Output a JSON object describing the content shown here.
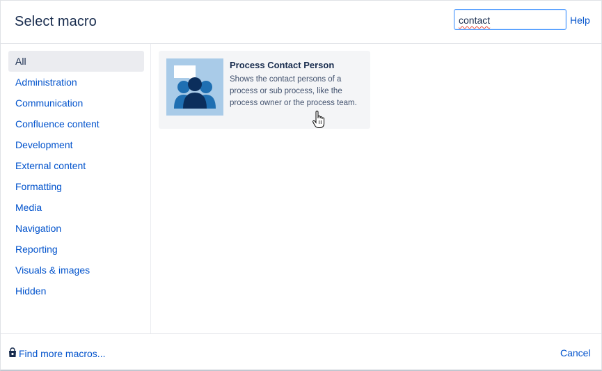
{
  "dialog": {
    "title": "Select macro",
    "search": {
      "value": "contact",
      "placeholder": ""
    },
    "help_label": "Help"
  },
  "sidebar": {
    "items": [
      {
        "label": "All",
        "selected": true
      },
      {
        "label": "Administration"
      },
      {
        "label": "Communication"
      },
      {
        "label": "Confluence content"
      },
      {
        "label": "Development"
      },
      {
        "label": "External content"
      },
      {
        "label": "Formatting"
      },
      {
        "label": "Media"
      },
      {
        "label": "Navigation"
      },
      {
        "label": "Reporting"
      },
      {
        "label": "Visuals & images"
      },
      {
        "label": "Hidden"
      }
    ]
  },
  "results": [
    {
      "name": "Process Contact Person",
      "description": "Shows the contact persons of a process or sub process, like the process owner or the process team.",
      "icon": "contact-persons-icon"
    }
  ],
  "footer": {
    "find_more_label": "Find more macros...",
    "cancel_label": "Cancel"
  },
  "colors": {
    "link": "#0052cc",
    "text": "#172b4d",
    "selected_bg": "#ebecf0",
    "card_bg": "#f4f5f7",
    "thumb_bg": "#a9cbe8",
    "icon_dark": "#0b2e5c",
    "icon_mid": "#1f6fb2"
  }
}
